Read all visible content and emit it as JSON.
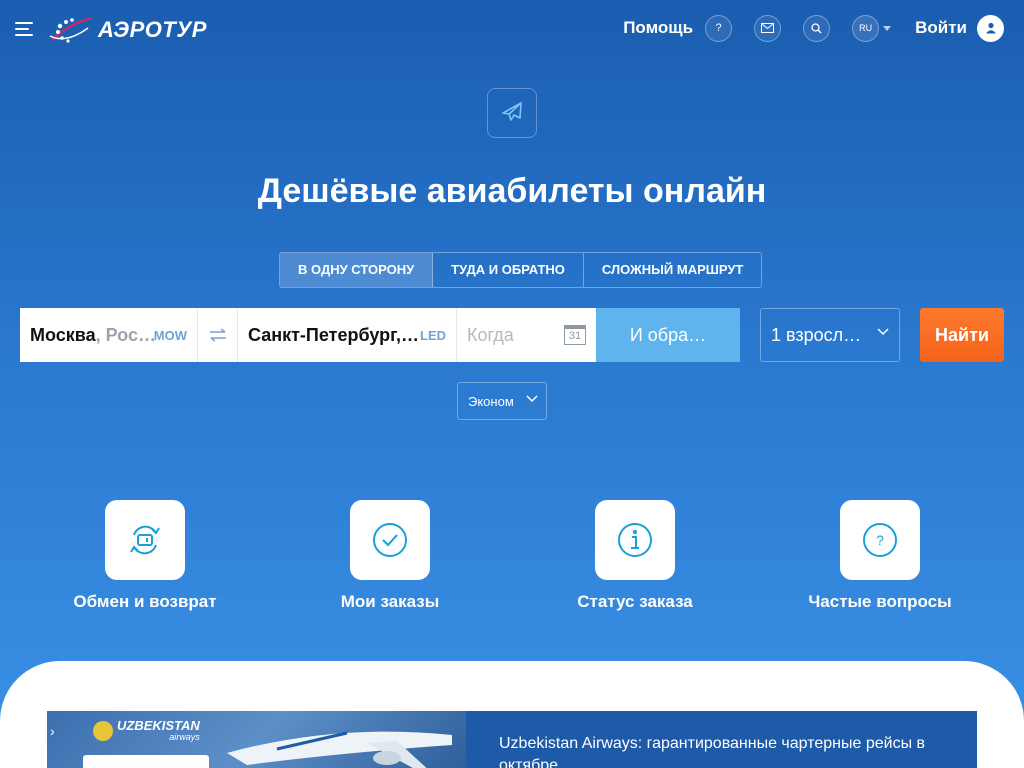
{
  "header": {
    "logo_text": "АЭРОТУР",
    "help_label": "Помощь",
    "help_icon_glyph": "?",
    "lang_label": "RU",
    "login_label": "Войти"
  },
  "hero": {
    "title": "Дешёвые авиабилеты онлайн",
    "tabs": [
      {
        "label": "В ОДНУ СТОРОНУ",
        "active": true
      },
      {
        "label": "ТУДА И ОБРАТНО",
        "active": false
      },
      {
        "label": "СЛОЖНЫЙ МАРШРУТ",
        "active": false
      }
    ]
  },
  "search": {
    "from_city": "Москва",
    "from_country": ", Рос…",
    "from_code": "MOW",
    "to_city": "Санкт-Петербург,…",
    "to_code": "LED",
    "when_placeholder": "Когда",
    "calendar_day": "31",
    "return_label": "И обра…",
    "passengers_label": "1 взросл…",
    "find_label": "Найти",
    "class_label": "Эконом"
  },
  "quick_links": [
    {
      "label": "Обмен и возврат",
      "icon": "exchange-icon"
    },
    {
      "label": "Мои заказы",
      "icon": "check-icon"
    },
    {
      "label": "Статус заказа",
      "icon": "info-icon"
    },
    {
      "label": "Частые вопросы",
      "icon": "question-icon"
    }
  ],
  "banner": {
    "brand_name": "UZBEKISTAN",
    "brand_sub": "airways",
    "text": "Uzbekistan Airways: гарантированные чартерные рейсы в октябре"
  },
  "colors": {
    "bg_top": "#1a5db0",
    "bg_bottom": "#3a92e6",
    "accent_orange": "#f4621a",
    "return_blue": "#5fb4ee",
    "icon_blue": "#1aa0d8"
  }
}
